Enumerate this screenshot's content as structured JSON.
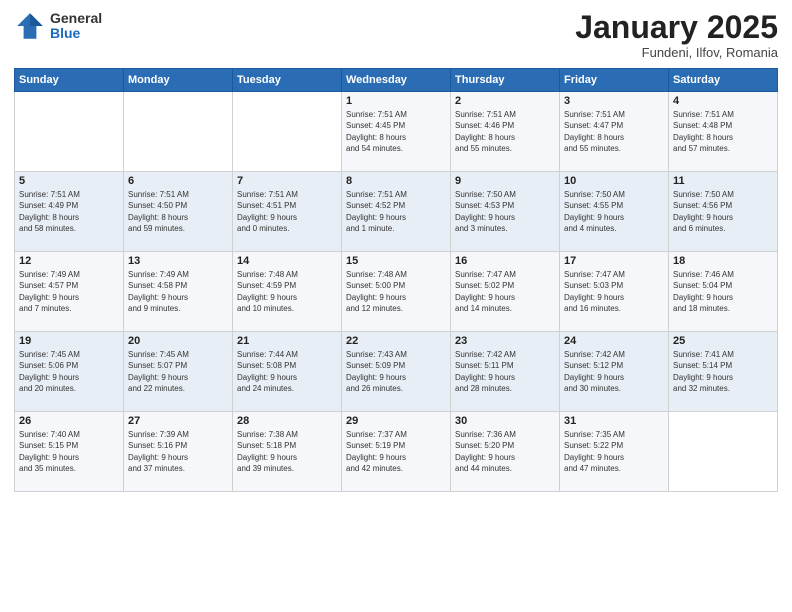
{
  "header": {
    "logo_general": "General",
    "logo_blue": "Blue",
    "month_title": "January 2025",
    "subtitle": "Fundeni, Ilfov, Romania"
  },
  "days_of_week": [
    "Sunday",
    "Monday",
    "Tuesday",
    "Wednesday",
    "Thursday",
    "Friday",
    "Saturday"
  ],
  "weeks": [
    [
      {
        "day": "",
        "detail": ""
      },
      {
        "day": "",
        "detail": ""
      },
      {
        "day": "",
        "detail": ""
      },
      {
        "day": "1",
        "detail": "Sunrise: 7:51 AM\nSunset: 4:45 PM\nDaylight: 8 hours\nand 54 minutes."
      },
      {
        "day": "2",
        "detail": "Sunrise: 7:51 AM\nSunset: 4:46 PM\nDaylight: 8 hours\nand 55 minutes."
      },
      {
        "day": "3",
        "detail": "Sunrise: 7:51 AM\nSunset: 4:47 PM\nDaylight: 8 hours\nand 55 minutes."
      },
      {
        "day": "4",
        "detail": "Sunrise: 7:51 AM\nSunset: 4:48 PM\nDaylight: 8 hours\nand 57 minutes."
      }
    ],
    [
      {
        "day": "5",
        "detail": "Sunrise: 7:51 AM\nSunset: 4:49 PM\nDaylight: 8 hours\nand 58 minutes."
      },
      {
        "day": "6",
        "detail": "Sunrise: 7:51 AM\nSunset: 4:50 PM\nDaylight: 8 hours\nand 59 minutes."
      },
      {
        "day": "7",
        "detail": "Sunrise: 7:51 AM\nSunset: 4:51 PM\nDaylight: 9 hours\nand 0 minutes."
      },
      {
        "day": "8",
        "detail": "Sunrise: 7:51 AM\nSunset: 4:52 PM\nDaylight: 9 hours\nand 1 minute."
      },
      {
        "day": "9",
        "detail": "Sunrise: 7:50 AM\nSunset: 4:53 PM\nDaylight: 9 hours\nand 3 minutes."
      },
      {
        "day": "10",
        "detail": "Sunrise: 7:50 AM\nSunset: 4:55 PM\nDaylight: 9 hours\nand 4 minutes."
      },
      {
        "day": "11",
        "detail": "Sunrise: 7:50 AM\nSunset: 4:56 PM\nDaylight: 9 hours\nand 6 minutes."
      }
    ],
    [
      {
        "day": "12",
        "detail": "Sunrise: 7:49 AM\nSunset: 4:57 PM\nDaylight: 9 hours\nand 7 minutes."
      },
      {
        "day": "13",
        "detail": "Sunrise: 7:49 AM\nSunset: 4:58 PM\nDaylight: 9 hours\nand 9 minutes."
      },
      {
        "day": "14",
        "detail": "Sunrise: 7:48 AM\nSunset: 4:59 PM\nDaylight: 9 hours\nand 10 minutes."
      },
      {
        "day": "15",
        "detail": "Sunrise: 7:48 AM\nSunset: 5:00 PM\nDaylight: 9 hours\nand 12 minutes."
      },
      {
        "day": "16",
        "detail": "Sunrise: 7:47 AM\nSunset: 5:02 PM\nDaylight: 9 hours\nand 14 minutes."
      },
      {
        "day": "17",
        "detail": "Sunrise: 7:47 AM\nSunset: 5:03 PM\nDaylight: 9 hours\nand 16 minutes."
      },
      {
        "day": "18",
        "detail": "Sunrise: 7:46 AM\nSunset: 5:04 PM\nDaylight: 9 hours\nand 18 minutes."
      }
    ],
    [
      {
        "day": "19",
        "detail": "Sunrise: 7:45 AM\nSunset: 5:06 PM\nDaylight: 9 hours\nand 20 minutes."
      },
      {
        "day": "20",
        "detail": "Sunrise: 7:45 AM\nSunset: 5:07 PM\nDaylight: 9 hours\nand 22 minutes."
      },
      {
        "day": "21",
        "detail": "Sunrise: 7:44 AM\nSunset: 5:08 PM\nDaylight: 9 hours\nand 24 minutes."
      },
      {
        "day": "22",
        "detail": "Sunrise: 7:43 AM\nSunset: 5:09 PM\nDaylight: 9 hours\nand 26 minutes."
      },
      {
        "day": "23",
        "detail": "Sunrise: 7:42 AM\nSunset: 5:11 PM\nDaylight: 9 hours\nand 28 minutes."
      },
      {
        "day": "24",
        "detail": "Sunrise: 7:42 AM\nSunset: 5:12 PM\nDaylight: 9 hours\nand 30 minutes."
      },
      {
        "day": "25",
        "detail": "Sunrise: 7:41 AM\nSunset: 5:14 PM\nDaylight: 9 hours\nand 32 minutes."
      }
    ],
    [
      {
        "day": "26",
        "detail": "Sunrise: 7:40 AM\nSunset: 5:15 PM\nDaylight: 9 hours\nand 35 minutes."
      },
      {
        "day": "27",
        "detail": "Sunrise: 7:39 AM\nSunset: 5:16 PM\nDaylight: 9 hours\nand 37 minutes."
      },
      {
        "day": "28",
        "detail": "Sunrise: 7:38 AM\nSunset: 5:18 PM\nDaylight: 9 hours\nand 39 minutes."
      },
      {
        "day": "29",
        "detail": "Sunrise: 7:37 AM\nSunset: 5:19 PM\nDaylight: 9 hours\nand 42 minutes."
      },
      {
        "day": "30",
        "detail": "Sunrise: 7:36 AM\nSunset: 5:20 PM\nDaylight: 9 hours\nand 44 minutes."
      },
      {
        "day": "31",
        "detail": "Sunrise: 7:35 AM\nSunset: 5:22 PM\nDaylight: 9 hours\nand 47 minutes."
      },
      {
        "day": "",
        "detail": ""
      }
    ]
  ]
}
